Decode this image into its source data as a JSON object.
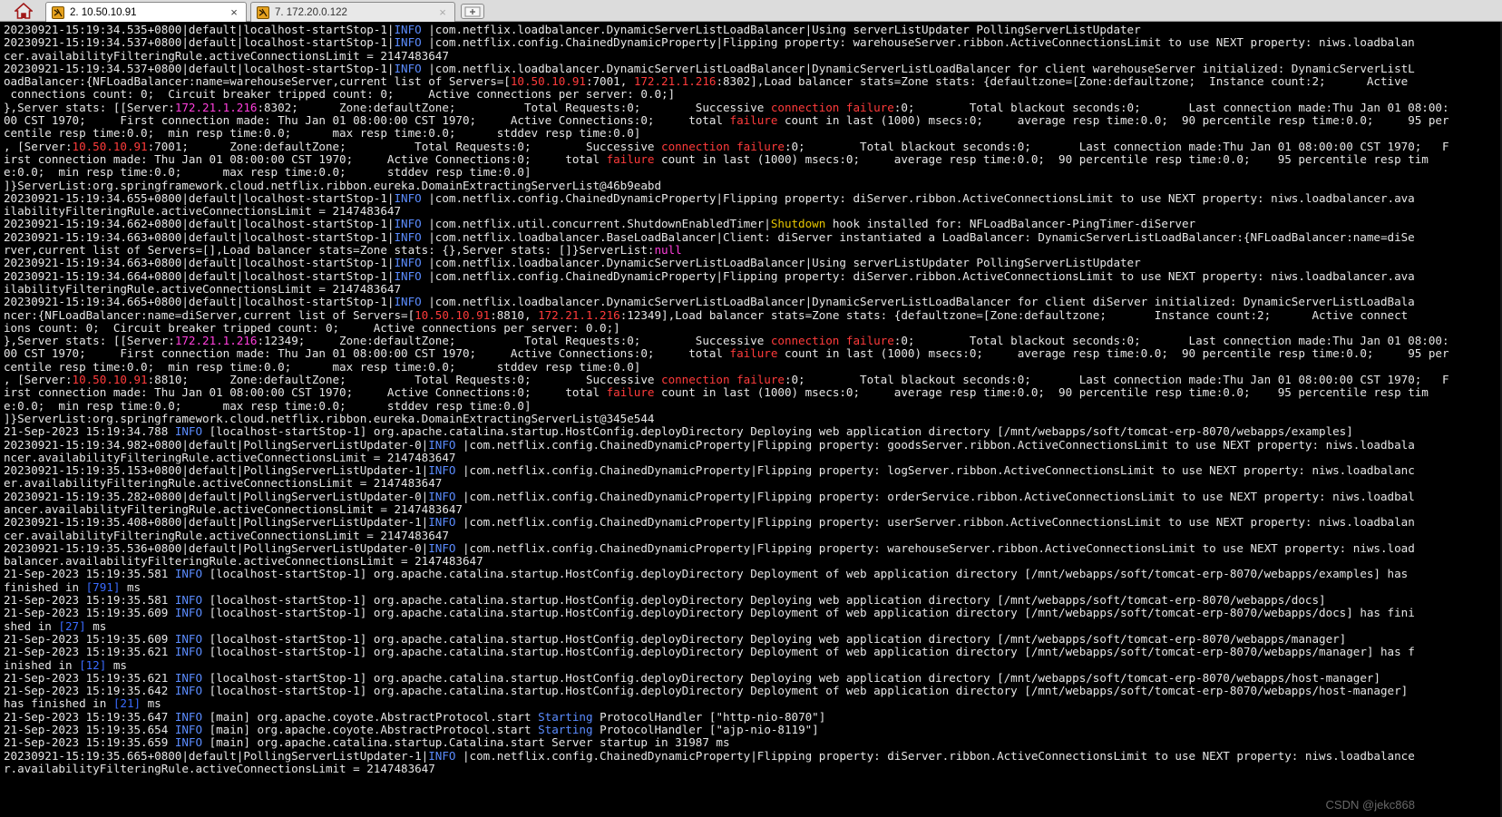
{
  "tabs": [
    {
      "label": "2. 10.50.10.91",
      "close": "×",
      "icon": "terminal-icon",
      "active": true
    },
    {
      "label": "7. 172.20.0.122",
      "close": "×",
      "icon": "terminal-icon",
      "active": false
    }
  ],
  "new_tab_icon": "add-tab-icon",
  "home_icon": "home-icon",
  "colors": {
    "background": "#000000",
    "text": "#e6e6e6",
    "info": "#5b8cff",
    "red": "#ff3b3b",
    "yellow": "#e5c400",
    "magenta": "#ff3fdc",
    "number": "#3a6bff"
  },
  "terminal": {
    "lines": [
      [
        [
          "20230921-15:19:34.535+0800|default|localhost-startStop-1|",
          ""
        ],
        [
          "INFO",
          "i"
        ],
        [
          " |com.netflix.loadbalancer.DynamicServerListLoadBalancer|Using serverListUpdater PollingServerListUpdater",
          ""
        ]
      ],
      [
        [
          "20230921-15:19:34.537+0800|default|localhost-startStop-1|",
          ""
        ],
        [
          "INFO",
          "i"
        ],
        [
          " |com.netflix.config.ChainedDynamicProperty|Flipping property: warehouseServer.ribbon.ActiveConnectionsLimit to use NEXT property: niws.loadbalan",
          ""
        ]
      ],
      [
        [
          "cer.availabilityFilteringRule.activeConnectionsLimit = 2147483647",
          ""
        ]
      ],
      [
        [
          "20230921-15:19:34.537+0800|default|localhost-startStop-1|",
          ""
        ],
        [
          "INFO",
          "i"
        ],
        [
          " |com.netflix.loadbalancer.DynamicServerListLoadBalancer|DynamicServerListLoadBalancer for client warehouseServer initialized: DynamicServerListL",
          ""
        ]
      ],
      [
        [
          "oadBalancer:{NFLoadBalancer:name=warehouseServer,current list of Servers=[",
          ""
        ],
        [
          "10.50.10.91",
          "r"
        ],
        [
          ":7001, ",
          ""
        ],
        [
          "172.21.1.216",
          "r"
        ],
        [
          ":8302],Load balancer stats=Zone stats: {defaultzone=[Zone:defaultzone;  Instance count:2;      Active",
          ""
        ]
      ],
      [
        [
          " connections count: 0;  Circuit breaker tripped count: 0;     Active connections per server: 0.0;]",
          ""
        ]
      ],
      [
        [
          "},Server stats: [[Server:",
          ""
        ],
        [
          "172.21.1.216",
          "m"
        ],
        [
          ":8302;      Zone:defaultZone;          Total Requests:0;        Successive ",
          ""
        ],
        [
          "connection failure",
          "r"
        ],
        [
          ":0;        Total blackout seconds:0;       Last connection made:Thu Jan 01 08:00:",
          ""
        ]
      ],
      [
        [
          "00 CST 1970;     First connection made: Thu Jan 01 08:00:00 CST 1970;     Active Connections:0;     total ",
          ""
        ],
        [
          "failure",
          "r"
        ],
        [
          " count in last (1000) msecs:0;     average resp time:0.0;  90 percentile resp time:0.0;     95 per",
          ""
        ]
      ],
      [
        [
          "centile resp time:0.0;  min resp time:0.0;      max resp time:0.0;      stddev resp time:0.0]",
          ""
        ]
      ],
      [
        [
          ", [Server:",
          ""
        ],
        [
          "10.50.10.91",
          "r"
        ],
        [
          ":7001;      Zone:defaultZone;          Total Requests:0;        Successive ",
          ""
        ],
        [
          "connection failure",
          "r"
        ],
        [
          ":0;        Total blackout seconds:0;       Last connection made:Thu Jan 01 08:00:00 CST 1970;   F",
          ""
        ]
      ],
      [
        [
          "irst connection made: Thu Jan 01 08:00:00 CST 1970;     Active Connections:0;     total ",
          ""
        ],
        [
          "failure",
          "r"
        ],
        [
          " count in last (1000) msecs:0;     average resp time:0.0;  90 percentile resp time:0.0;    95 percentile resp tim",
          ""
        ]
      ],
      [
        [
          "e:0.0;  min resp time:0.0;      max resp time:0.0;      stddev resp time:0.0]",
          ""
        ]
      ],
      [
        [
          "]}ServerList:org.springframework.cloud.netflix.ribbon.eureka.DomainExtractingServerList@46b9eabd",
          ""
        ]
      ],
      [
        [
          "20230921-15:19:34.655+0800|default|localhost-startStop-1|",
          ""
        ],
        [
          "INFO",
          "i"
        ],
        [
          " |com.netflix.config.ChainedDynamicProperty|Flipping property: diServer.ribbon.ActiveConnectionsLimit to use NEXT property: niws.loadbalancer.ava",
          ""
        ]
      ],
      [
        [
          "ilabilityFilteringRule.activeConnectionsLimit = 2147483647",
          ""
        ]
      ],
      [
        [
          "20230921-15:19:34.662+0800|default|localhost-startStop-1|",
          ""
        ],
        [
          "INFO",
          "i"
        ],
        [
          " |com.netflix.util.concurrent.ShutdownEnabledTimer|",
          ""
        ],
        [
          "Shutdown",
          "y"
        ],
        [
          " hook installed for: NFLoadBalancer-PingTimer-diServer",
          ""
        ]
      ],
      [
        [
          "20230921-15:19:34.663+0800|default|localhost-startStop-1|",
          ""
        ],
        [
          "INFO",
          "i"
        ],
        [
          " |com.netflix.loadbalancer.BaseLoadBalancer|Client: diServer instantiated a LoadBalancer: DynamicServerListLoadBalancer:{NFLoadBalancer:name=diSe",
          ""
        ]
      ],
      [
        [
          "rver,current list of Servers=[],Load balancer stats=Zone stats: {},Server stats: []}ServerList:",
          ""
        ],
        [
          "null",
          "m"
        ]
      ],
      [
        [
          "20230921-15:19:34.663+0800|default|localhost-startStop-1|",
          ""
        ],
        [
          "INFO",
          "i"
        ],
        [
          " |com.netflix.loadbalancer.DynamicServerListLoadBalancer|Using serverListUpdater PollingServerListUpdater",
          ""
        ]
      ],
      [
        [
          "20230921-15:19:34.664+0800|default|localhost-startStop-1|",
          ""
        ],
        [
          "INFO",
          "i"
        ],
        [
          " |com.netflix.config.ChainedDynamicProperty|Flipping property: diServer.ribbon.ActiveConnectionsLimit to use NEXT property: niws.loadbalancer.ava",
          ""
        ]
      ],
      [
        [
          "ilabilityFilteringRule.activeConnectionsLimit = 2147483647",
          ""
        ]
      ],
      [
        [
          "20230921-15:19:34.665+0800|default|localhost-startStop-1|",
          ""
        ],
        [
          "INFO",
          "i"
        ],
        [
          " |com.netflix.loadbalancer.DynamicServerListLoadBalancer|DynamicServerListLoadBalancer for client diServer initialized: DynamicServerListLoadBala",
          ""
        ]
      ],
      [
        [
          "ncer:{NFLoadBalancer:name=diServer,current list of Servers=[",
          ""
        ],
        [
          "10.50.10.91",
          "r"
        ],
        [
          ":8810, ",
          ""
        ],
        [
          "172.21.1.216",
          "r"
        ],
        [
          ":12349],Load balancer stats=Zone stats: {defaultzone=[Zone:defaultzone;       Instance count:2;      Active connect",
          ""
        ]
      ],
      [
        [
          "ions count: 0;  Circuit breaker tripped count: 0;     Active connections per server: 0.0;]",
          ""
        ]
      ],
      [
        [
          "},Server stats: [[Server:",
          ""
        ],
        [
          "172.21.1.216",
          "m"
        ],
        [
          ":12349;     Zone:defaultZone;          Total Requests:0;        Successive ",
          ""
        ],
        [
          "connection failure",
          "r"
        ],
        [
          ":0;        Total blackout seconds:0;       Last connection made:Thu Jan 01 08:00:",
          ""
        ]
      ],
      [
        [
          "00 CST 1970;     First connection made: Thu Jan 01 08:00:00 CST 1970;     Active Connections:0;     total ",
          ""
        ],
        [
          "failure",
          "r"
        ],
        [
          " count in last (1000) msecs:0;     average resp time:0.0;  90 percentile resp time:0.0;     95 per",
          ""
        ]
      ],
      [
        [
          "centile resp time:0.0;  min resp time:0.0;      max resp time:0.0;      stddev resp time:0.0]",
          ""
        ]
      ],
      [
        [
          ", [Server:",
          ""
        ],
        [
          "10.50.10.91",
          "r"
        ],
        [
          ":8810;      Zone:defaultZone;          Total Requests:0;        Successive ",
          ""
        ],
        [
          "connection failure",
          "r"
        ],
        [
          ":0;        Total blackout seconds:0;       Last connection made:Thu Jan 01 08:00:00 CST 1970;   F",
          ""
        ]
      ],
      [
        [
          "irst connection made: Thu Jan 01 08:00:00 CST 1970;     Active Connections:0;     total ",
          ""
        ],
        [
          "failure",
          "r"
        ],
        [
          " count in last (1000) msecs:0;     average resp time:0.0;  90 percentile resp time:0.0;    95 percentile resp tim",
          ""
        ]
      ],
      [
        [
          "e:0.0;  min resp time:0.0;      max resp time:0.0;      stddev resp time:0.0]",
          ""
        ]
      ],
      [
        [
          "]}ServerList:org.springframework.cloud.netflix.ribbon.eureka.DomainExtractingServerList@345e544",
          ""
        ]
      ],
      [
        [
          "21-Sep-2023 15:19:34.788 ",
          ""
        ],
        [
          "INFO",
          "i"
        ],
        [
          " [localhost-startStop-1] org.apache.catalina.startup.HostConfig.deployDirectory Deploying web application directory [/mnt/webapps/soft/tomcat-erp-8070/webapps/examples]",
          ""
        ]
      ],
      [
        [
          "20230921-15:19:34.982+0800|default|PollingServerListUpdater-0|",
          ""
        ],
        [
          "INFO",
          "i"
        ],
        [
          " |com.netflix.config.ChainedDynamicProperty|Flipping property: goodsServer.ribbon.ActiveConnectionsLimit to use NEXT property: niws.loadbala",
          ""
        ]
      ],
      [
        [
          "ncer.availabilityFilteringRule.activeConnectionsLimit = 2147483647",
          ""
        ]
      ],
      [
        [
          "20230921-15:19:35.153+0800|default|PollingServerListUpdater-1|",
          ""
        ],
        [
          "INFO",
          "i"
        ],
        [
          " |com.netflix.config.ChainedDynamicProperty|Flipping property: logServer.ribbon.ActiveConnectionsLimit to use NEXT property: niws.loadbalanc",
          ""
        ]
      ],
      [
        [
          "er.availabilityFilteringRule.activeConnectionsLimit = 2147483647",
          ""
        ]
      ],
      [
        [
          "20230921-15:19:35.282+0800|default|PollingServerListUpdater-0|",
          ""
        ],
        [
          "INFO",
          "i"
        ],
        [
          " |com.netflix.config.ChainedDynamicProperty|Flipping property: orderService.ribbon.ActiveConnectionsLimit to use NEXT property: niws.loadbal",
          ""
        ]
      ],
      [
        [
          "ancer.availabilityFilteringRule.activeConnectionsLimit = 2147483647",
          ""
        ]
      ],
      [
        [
          "20230921-15:19:35.408+0800|default|PollingServerListUpdater-1|",
          ""
        ],
        [
          "INFO",
          "i"
        ],
        [
          " |com.netflix.config.ChainedDynamicProperty|Flipping property: userServer.ribbon.ActiveConnectionsLimit to use NEXT property: niws.loadbalan",
          ""
        ]
      ],
      [
        [
          "cer.availabilityFilteringRule.activeConnectionsLimit = 2147483647",
          ""
        ]
      ],
      [
        [
          "20230921-15:19:35.536+0800|default|PollingServerListUpdater-0|",
          ""
        ],
        [
          "INFO",
          "i"
        ],
        [
          " |com.netflix.config.ChainedDynamicProperty|Flipping property: warehouseServer.ribbon.ActiveConnectionsLimit to use NEXT property: niws.load",
          ""
        ]
      ],
      [
        [
          "balancer.availabilityFilteringRule.activeConnectionsLimit = 2147483647",
          ""
        ]
      ],
      [
        [
          "21-Sep-2023 15:19:35.581 ",
          ""
        ],
        [
          "INFO",
          "i"
        ],
        [
          " [localhost-startStop-1] org.apache.catalina.startup.HostConfig.deployDirectory Deployment of web application directory [/mnt/webapps/soft/tomcat-erp-8070/webapps/examples] has",
          ""
        ]
      ],
      [
        [
          "finished in ",
          ""
        ],
        [
          "[791]",
          "b"
        ],
        [
          " ms",
          ""
        ]
      ],
      [
        [
          "21-Sep-2023 15:19:35.581 ",
          ""
        ],
        [
          "INFO",
          "i"
        ],
        [
          " [localhost-startStop-1] org.apache.catalina.startup.HostConfig.deployDirectory Deploying web application directory [/mnt/webapps/soft/tomcat-erp-8070/webapps/docs]",
          ""
        ]
      ],
      [
        [
          "21-Sep-2023 15:19:35.609 ",
          ""
        ],
        [
          "INFO",
          "i"
        ],
        [
          " [localhost-startStop-1] org.apache.catalina.startup.HostConfig.deployDirectory Deployment of web application directory [/mnt/webapps/soft/tomcat-erp-8070/webapps/docs] has fini",
          ""
        ]
      ],
      [
        [
          "shed in ",
          ""
        ],
        [
          "[27]",
          "b"
        ],
        [
          " ms",
          ""
        ]
      ],
      [
        [
          "21-Sep-2023 15:19:35.609 ",
          ""
        ],
        [
          "INFO",
          "i"
        ],
        [
          " [localhost-startStop-1] org.apache.catalina.startup.HostConfig.deployDirectory Deploying web application directory [/mnt/webapps/soft/tomcat-erp-8070/webapps/manager]",
          ""
        ]
      ],
      [
        [
          "21-Sep-2023 15:19:35.621 ",
          ""
        ],
        [
          "INFO",
          "i"
        ],
        [
          " [localhost-startStop-1] org.apache.catalina.startup.HostConfig.deployDirectory Deployment of web application directory [/mnt/webapps/soft/tomcat-erp-8070/webapps/manager] has f",
          ""
        ]
      ],
      [
        [
          "inished in ",
          ""
        ],
        [
          "[12]",
          "b"
        ],
        [
          " ms",
          ""
        ]
      ],
      [
        [
          "21-Sep-2023 15:19:35.621 ",
          ""
        ],
        [
          "INFO",
          "i"
        ],
        [
          " [localhost-startStop-1] org.apache.catalina.startup.HostConfig.deployDirectory Deploying web application directory [/mnt/webapps/soft/tomcat-erp-8070/webapps/host-manager]",
          ""
        ]
      ],
      [
        [
          "21-Sep-2023 15:19:35.642 ",
          ""
        ],
        [
          "INFO",
          "i"
        ],
        [
          " [localhost-startStop-1] org.apache.catalina.startup.HostConfig.deployDirectory Deployment of web application directory [/mnt/webapps/soft/tomcat-erp-8070/webapps/host-manager]",
          ""
        ]
      ],
      [
        [
          "has finished in ",
          ""
        ],
        [
          "[21]",
          "b"
        ],
        [
          " ms",
          ""
        ]
      ],
      [
        [
          "21-Sep-2023 15:19:35.647 ",
          ""
        ],
        [
          "INFO",
          "i"
        ],
        [
          " [main] org.apache.coyote.AbstractProtocol.start ",
          ""
        ],
        [
          "Starting",
          "i"
        ],
        [
          " ProtocolHandler [\"http-nio-8070\"]",
          ""
        ]
      ],
      [
        [
          "21-Sep-2023 15:19:35.654 ",
          ""
        ],
        [
          "INFO",
          "i"
        ],
        [
          " [main] org.apache.coyote.AbstractProtocol.start ",
          ""
        ],
        [
          "Starting",
          "i"
        ],
        [
          " ProtocolHandler [\"ajp-nio-8119\"]",
          ""
        ]
      ],
      [
        [
          "21-Sep-2023 15:19:35.659 ",
          ""
        ],
        [
          "INFO",
          "i"
        ],
        [
          " [main] org.apache.catalina.startup.Catalina.start Server startup in 31987 ms",
          ""
        ]
      ],
      [
        [
          "20230921-15:19:35.665+0800|default|PollingServerListUpdater-1|",
          ""
        ],
        [
          "INFO",
          "i"
        ],
        [
          " |com.netflix.config.ChainedDynamicProperty|Flipping property: diServer.ribbon.ActiveConnectionsLimit to use NEXT property: niws.loadbalance",
          ""
        ]
      ],
      [
        [
          "r.availabilityFilteringRule.activeConnectionsLimit = 2147483647",
          ""
        ]
      ]
    ]
  },
  "watermark": "CSDN @jekc868"
}
